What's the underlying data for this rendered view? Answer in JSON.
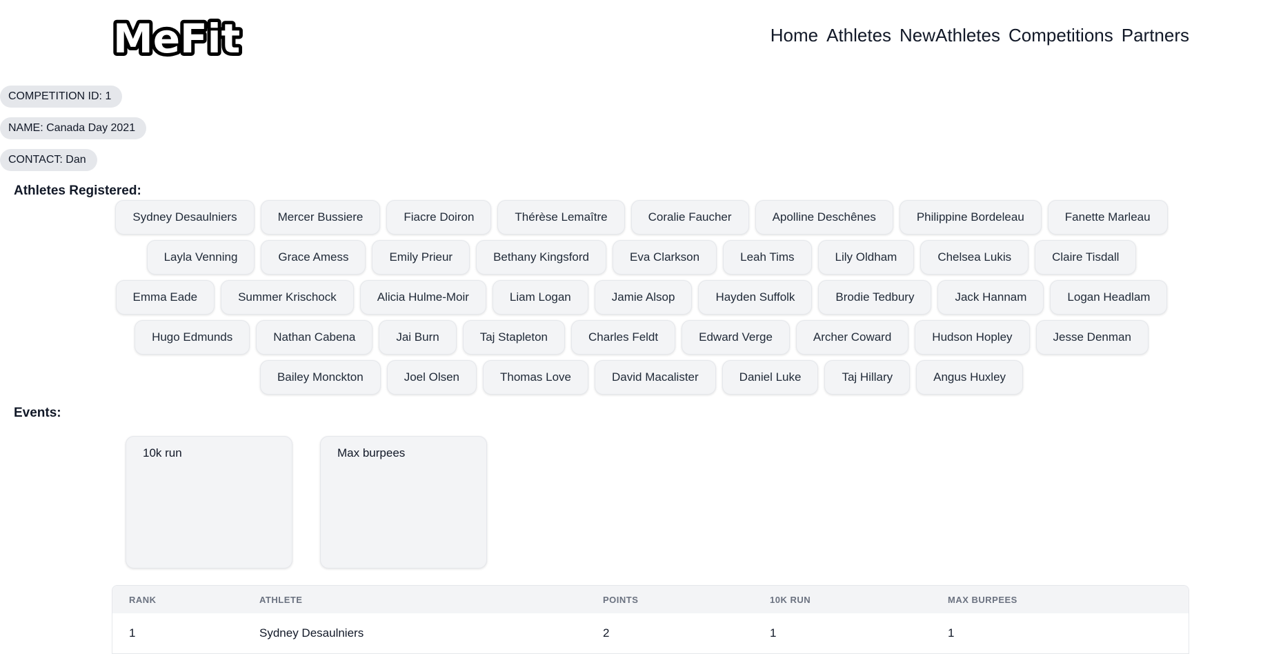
{
  "header": {
    "logo_text": "MeFit",
    "nav": [
      "Home",
      "Athletes",
      "NewAthletes",
      "Competitions",
      "Partners"
    ]
  },
  "competition": {
    "id_label": "COMPETITION ID: 1",
    "name_label": "NAME: Canada Day 2021",
    "contact_label": "CONTACT: Dan"
  },
  "athletes_section": {
    "title": "Athletes Registered:",
    "athletes": [
      "Sydney Desaulniers",
      "Mercer Bussiere",
      "Fiacre Doiron",
      "Thérèse Lemaître",
      "Coralie Faucher",
      "Apolline Deschênes",
      "Philippine Bordeleau",
      "Fanette Marleau",
      "Layla Venning",
      "Grace Amess",
      "Emily Prieur",
      "Bethany Kingsford",
      "Eva Clarkson",
      "Leah Tims",
      "Lily Oldham",
      "Chelsea Lukis",
      "Claire Tisdall",
      "Emma Eade",
      "Summer Krischock",
      "Alicia Hulme-Moir",
      "Liam Logan",
      "Jamie Alsop",
      "Hayden Suffolk",
      "Brodie Tedbury",
      "Jack Hannam",
      "Logan Headlam",
      "Hugo Edmunds",
      "Nathan Cabena",
      "Jai Burn",
      "Taj Stapleton",
      "Charles Feldt",
      "Edward Verge",
      "Archer Coward",
      "Hudson Hopley",
      "Jesse Denman",
      "Bailey Monckton",
      "Joel Olsen",
      "Thomas Love",
      "David Macalister",
      "Daniel Luke",
      "Taj Hillary",
      "Angus Huxley"
    ]
  },
  "events_section": {
    "title": "Events:",
    "events": [
      "10k run",
      "Max burpees"
    ]
  },
  "results_table": {
    "headers": [
      "RANK",
      "ATHLETE",
      "POINTS",
      "10K RUN",
      "MAX BURPEES"
    ],
    "rows": [
      [
        "1",
        "Sydney Desaulniers",
        "2",
        "1",
        "1"
      ]
    ]
  }
}
